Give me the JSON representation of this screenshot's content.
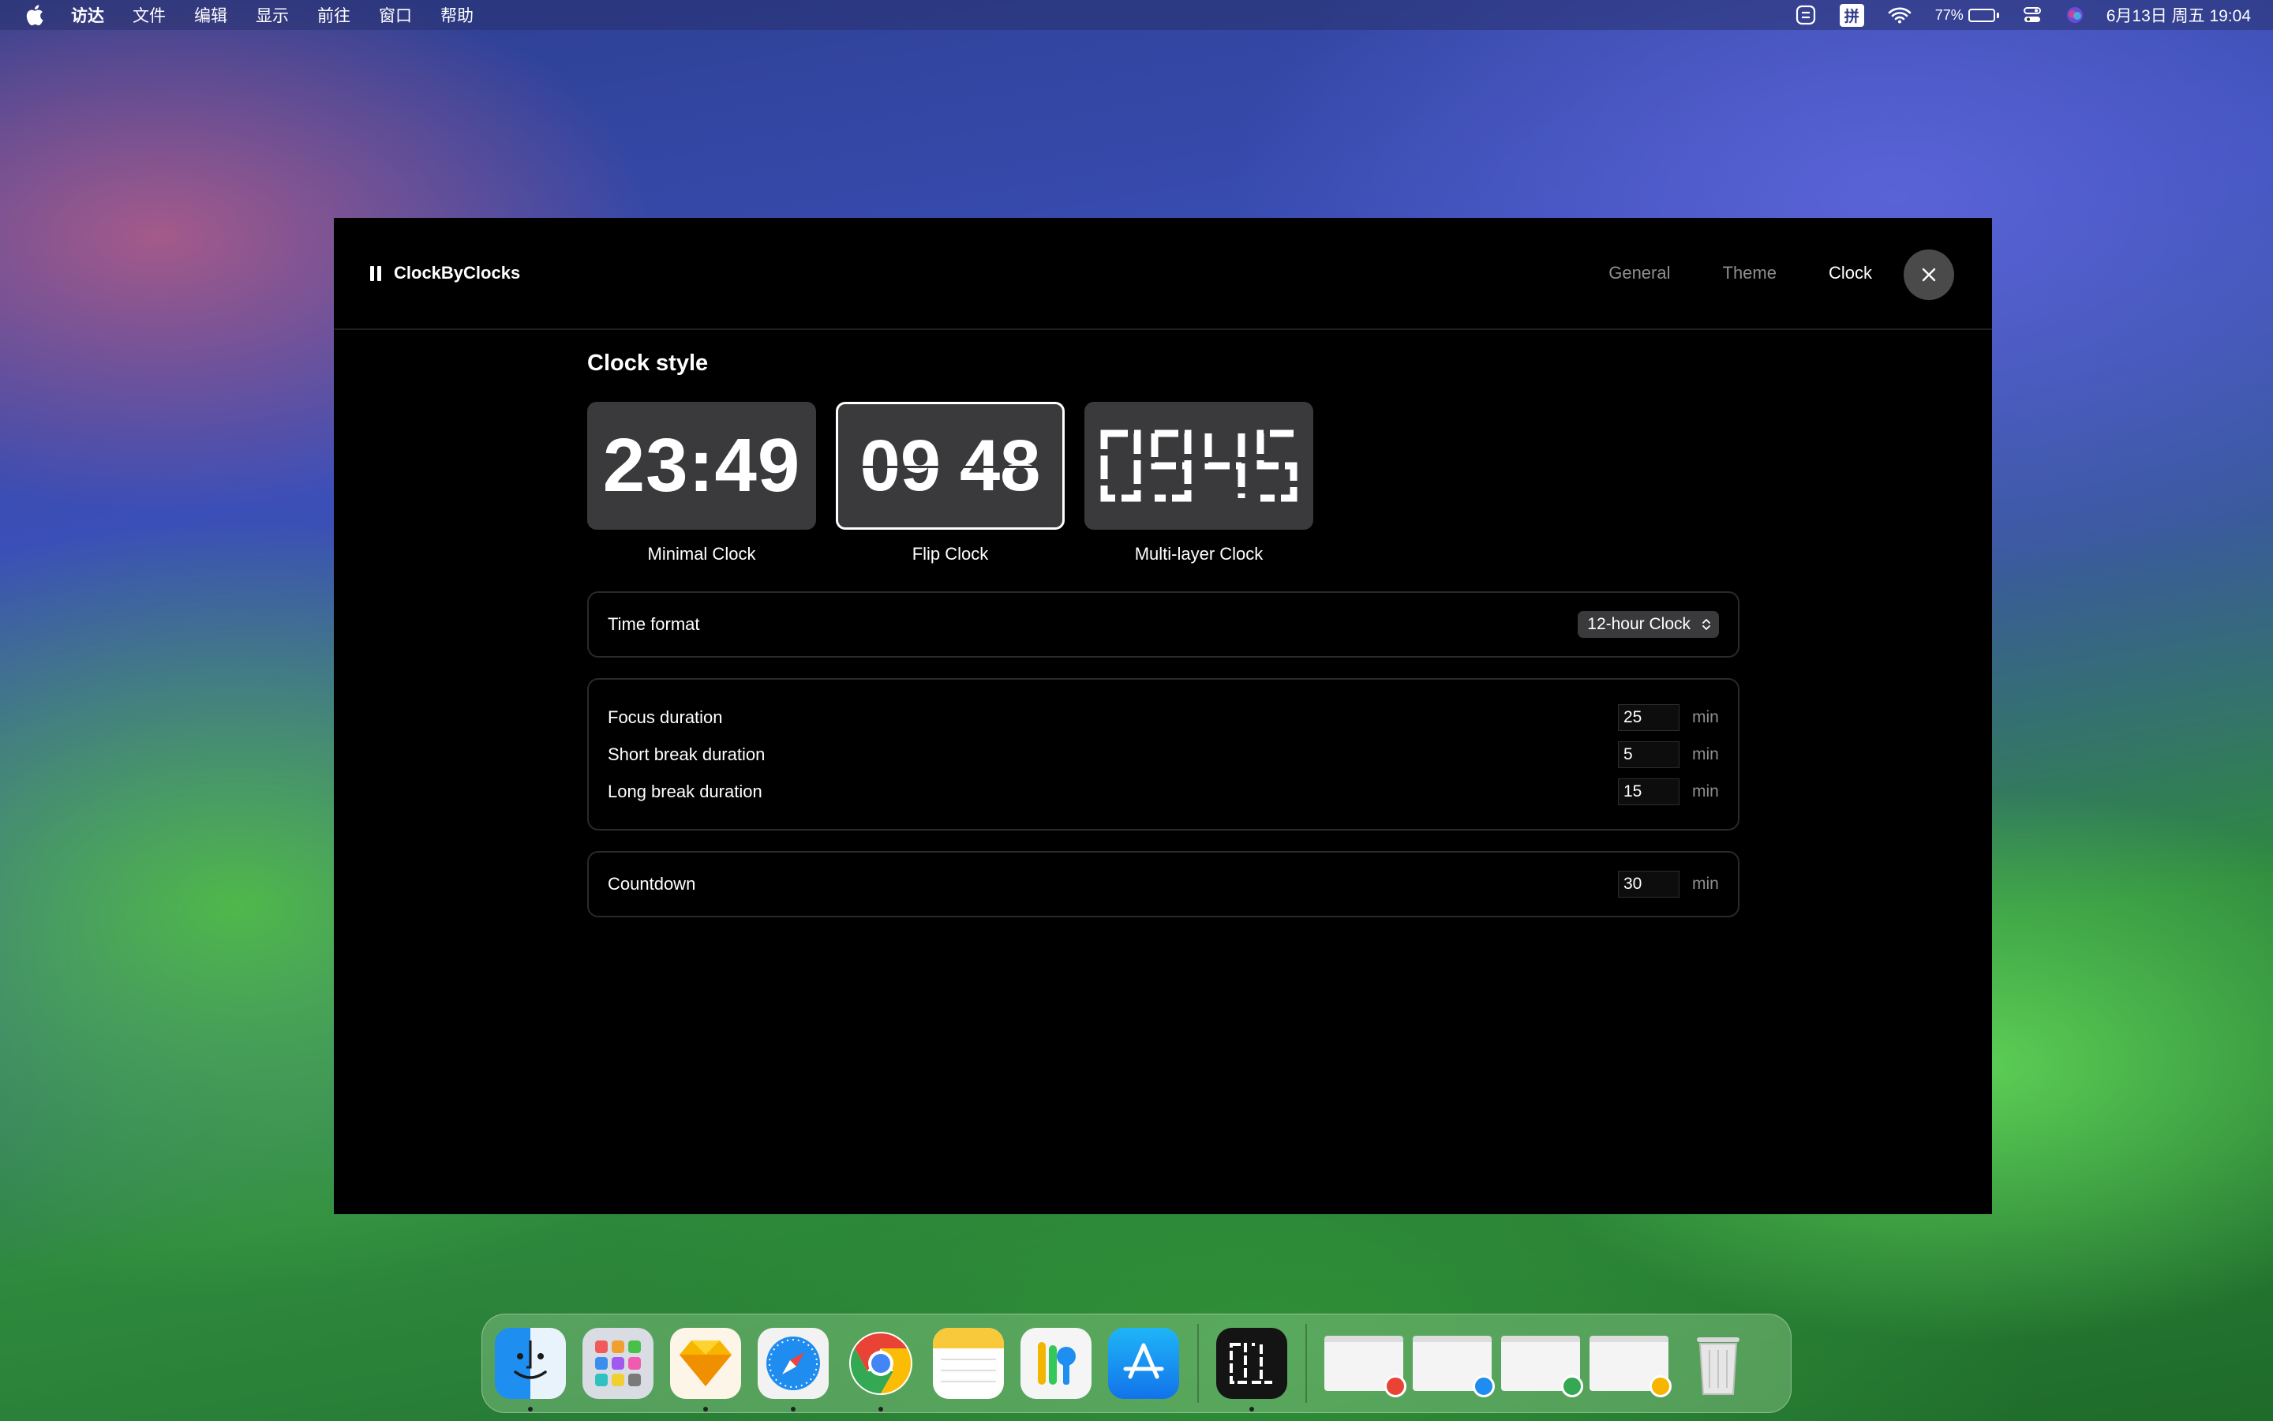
{
  "menubar": {
    "items": [
      "访达",
      "文件",
      "编辑",
      "显示",
      "前往",
      "窗口",
      "帮助"
    ],
    "ime": "拼",
    "battery_percent": "77%",
    "battery_level": 0.77,
    "datetime": "6月13日 周五  19:04"
  },
  "window": {
    "app_name": "ClockByClocks",
    "tabs": [
      "General",
      "Theme",
      "Clock"
    ],
    "active_tab": "Clock",
    "section_title": "Clock style",
    "clock_styles": [
      {
        "label": "Minimal Clock",
        "preview": "23:49",
        "selected": false
      },
      {
        "label": "Flip Clock",
        "preview_hours": "09",
        "preview_minutes": "48",
        "selected": true
      },
      {
        "label": "Multi-layer Clock",
        "preview": "0945",
        "selected": false
      }
    ],
    "time_format": {
      "label": "Time format",
      "value": "12-hour Clock"
    },
    "durations": [
      {
        "label": "Focus duration",
        "value": "25",
        "unit": "min"
      },
      {
        "label": "Short break duration",
        "value": "5",
        "unit": "min"
      },
      {
        "label": "Long break duration",
        "value": "15",
        "unit": "min"
      }
    ],
    "countdown": {
      "label": "Countdown",
      "value": "30",
      "unit": "min"
    }
  },
  "dock": {
    "apps": [
      "finder",
      "launchpad",
      "sketch",
      "safari",
      "chrome",
      "notes",
      "passwords",
      "app-store",
      "clockbyclocks"
    ],
    "recent_windows": 4
  }
}
